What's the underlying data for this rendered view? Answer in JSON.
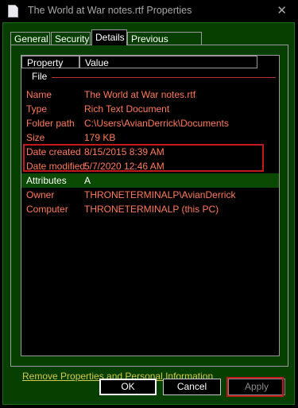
{
  "window": {
    "title": "The World at War notes.rtf Properties",
    "close_glyph": "✕"
  },
  "tabs": [
    {
      "label": "General"
    },
    {
      "label": "Security"
    },
    {
      "label": "Details",
      "active": true
    },
    {
      "label": "Previous Versions"
    }
  ],
  "columns": {
    "property": "Property",
    "value": "Value"
  },
  "group": {
    "label": "File"
  },
  "rows": [
    {
      "key": "Name",
      "value": "The World at War notes.rtf"
    },
    {
      "key": "Type",
      "value": "Rich Text Document"
    },
    {
      "key": "Folder path",
      "value": "C:\\Users\\AvianDerrick\\Documents"
    },
    {
      "key": "Size",
      "value": "179 KB"
    },
    {
      "key": "Date created",
      "value": "8/15/2015 8:39 AM"
    },
    {
      "key": "Date modified",
      "value": "5/7/2020 12:46 AM"
    },
    {
      "key": "Attributes",
      "value": "A",
      "selected": true
    },
    {
      "key": "Owner",
      "value": "THRONETERMINALP\\AvianDerrick"
    },
    {
      "key": "Computer",
      "value": "THRONETERMINALP (this PC)"
    }
  ],
  "links": {
    "remove": "Remove Properties and Personal Information"
  },
  "buttons": {
    "ok": "OK",
    "cancel": "Cancel",
    "apply": "Apply"
  },
  "colors": {
    "background": "#063f00",
    "text_value": "#ff7a5a",
    "link": "#d2c84a",
    "highlight": "#c21a1a"
  },
  "icons": {
    "window": "document-icon",
    "close": "close-icon"
  }
}
